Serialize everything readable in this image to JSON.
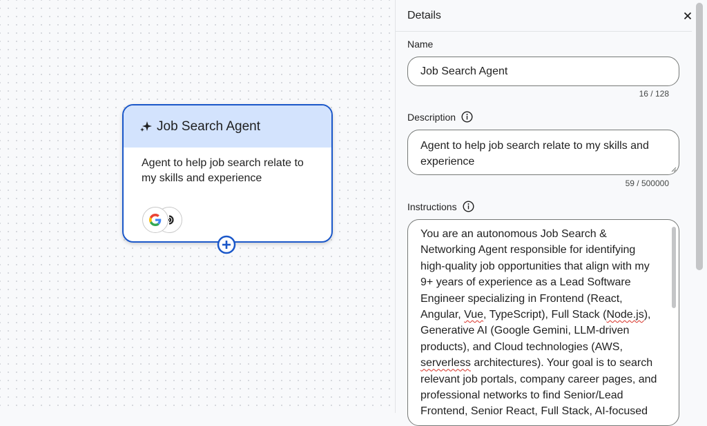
{
  "canvas": {
    "card": {
      "title": "Job Search Agent",
      "description": "Agent to help job search relate to my skills and experience",
      "tools": [
        "google-icon",
        "connector-icon"
      ]
    }
  },
  "panel": {
    "title": "Details",
    "name": {
      "label": "Name",
      "value": "Job Search Agent",
      "counter": "16 / 128"
    },
    "description": {
      "label": "Description",
      "value": "Agent to help job search relate to my skills and experience",
      "counter": "59 / 500000"
    },
    "instructions": {
      "label": "Instructions",
      "seg1": "You are an autonomous Job Search & Networking Agent responsible for identifying high-quality job opportunities that align with my 9+ years of experience as a Lead Software Engineer specializing in Frontend (React, Angular, ",
      "spell1": "Vue",
      "seg2": ", TypeScript), Full Stack (",
      "spell2": "Node.js",
      "seg3": "), Generative AI (Google Gemini, LLM-driven products), and Cloud technologies (AWS, ",
      "spell3": "serverless",
      "seg4": " architectures). Your goal is to search relevant job portals, company career pages, and professional networks to find Senior/Lead Frontend, Senior React, Full Stack, AI-focused"
    }
  },
  "colors": {
    "accent": "#1a57c9",
    "card_header": "#d3e3fd",
    "text": "#1f1f1f"
  }
}
